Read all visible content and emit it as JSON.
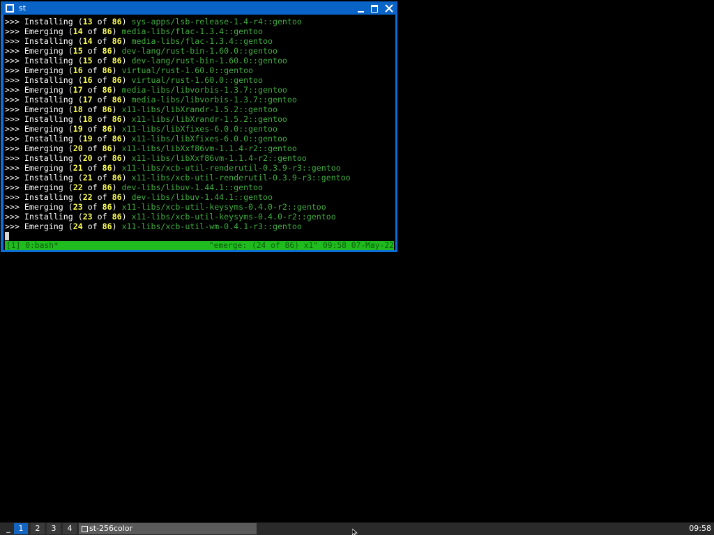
{
  "window": {
    "title": "st"
  },
  "terminal": {
    "lines": [
      {
        "prefix": ">>> ",
        "action": "Installing",
        "cur": "13",
        "of": "of",
        "total": "86",
        "pkg": "sys-apps/lsb-release-1.4-r4::gentoo"
      },
      {
        "prefix": ">>> ",
        "action": "Emerging",
        "cur": "14",
        "of": "of",
        "total": "86",
        "pkg": "media-libs/flac-1.3.4::gentoo"
      },
      {
        "prefix": ">>> ",
        "action": "Installing",
        "cur": "14",
        "of": "of",
        "total": "86",
        "pkg": "media-libs/flac-1.3.4::gentoo"
      },
      {
        "prefix": ">>> ",
        "action": "Emerging",
        "cur": "15",
        "of": "of",
        "total": "86",
        "pkg": "dev-lang/rust-bin-1.60.0::gentoo"
      },
      {
        "prefix": ">>> ",
        "action": "Installing",
        "cur": "15",
        "of": "of",
        "total": "86",
        "pkg": "dev-lang/rust-bin-1.60.0::gentoo"
      },
      {
        "prefix": ">>> ",
        "action": "Emerging",
        "cur": "16",
        "of": "of",
        "total": "86",
        "pkg": "virtual/rust-1.60.0::gentoo"
      },
      {
        "prefix": ">>> ",
        "action": "Installing",
        "cur": "16",
        "of": "of",
        "total": "86",
        "pkg": "virtual/rust-1.60.0::gentoo"
      },
      {
        "prefix": ">>> ",
        "action": "Emerging",
        "cur": "17",
        "of": "of",
        "total": "86",
        "pkg": "media-libs/libvorbis-1.3.7::gentoo"
      },
      {
        "prefix": ">>> ",
        "action": "Installing",
        "cur": "17",
        "of": "of",
        "total": "86",
        "pkg": "media-libs/libvorbis-1.3.7::gentoo"
      },
      {
        "prefix": ">>> ",
        "action": "Emerging",
        "cur": "18",
        "of": "of",
        "total": "86",
        "pkg": "x11-libs/libXrandr-1.5.2::gentoo"
      },
      {
        "prefix": ">>> ",
        "action": "Installing",
        "cur": "18",
        "of": "of",
        "total": "86",
        "pkg": "x11-libs/libXrandr-1.5.2::gentoo"
      },
      {
        "prefix": ">>> ",
        "action": "Emerging",
        "cur": "19",
        "of": "of",
        "total": "86",
        "pkg": "x11-libs/libXfixes-6.0.0::gentoo"
      },
      {
        "prefix": ">>> ",
        "action": "Installing",
        "cur": "19",
        "of": "of",
        "total": "86",
        "pkg": "x11-libs/libXfixes-6.0.0::gentoo"
      },
      {
        "prefix": ">>> ",
        "action": "Emerging",
        "cur": "20",
        "of": "of",
        "total": "86",
        "pkg": "x11-libs/libXxf86vm-1.1.4-r2::gentoo"
      },
      {
        "prefix": ">>> ",
        "action": "Installing",
        "cur": "20",
        "of": "of",
        "total": "86",
        "pkg": "x11-libs/libXxf86vm-1.1.4-r2::gentoo"
      },
      {
        "prefix": ">>> ",
        "action": "Emerging",
        "cur": "21",
        "of": "of",
        "total": "86",
        "pkg": "x11-libs/xcb-util-renderutil-0.3.9-r3::gentoo"
      },
      {
        "prefix": ">>> ",
        "action": "Installing",
        "cur": "21",
        "of": "of",
        "total": "86",
        "pkg": "x11-libs/xcb-util-renderutil-0.3.9-r3::gentoo"
      },
      {
        "prefix": ">>> ",
        "action": "Emerging",
        "cur": "22",
        "of": "of",
        "total": "86",
        "pkg": "dev-libs/libuv-1.44.1::gentoo"
      },
      {
        "prefix": ">>> ",
        "action": "Installing",
        "cur": "22",
        "of": "of",
        "total": "86",
        "pkg": "dev-libs/libuv-1.44.1::gentoo"
      },
      {
        "prefix": ">>> ",
        "action": "Emerging",
        "cur": "23",
        "of": "of",
        "total": "86",
        "pkg": "x11-libs/xcb-util-keysyms-0.4.0-r2::gentoo"
      },
      {
        "prefix": ">>> ",
        "action": "Installing",
        "cur": "23",
        "of": "of",
        "total": "86",
        "pkg": "x11-libs/xcb-util-keysyms-0.4.0-r2::gentoo"
      },
      {
        "prefix": ">>> ",
        "action": "Emerging",
        "cur": "24",
        "of": "of",
        "total": "86",
        "pkg": "x11-libs/xcb-util-wm-0.4.1-r3::gentoo"
      }
    ],
    "status_left": "[1] 0:bash*",
    "status_right": "\"emerge: (24 of 86) x1\" 09:58 07-May-22"
  },
  "taskbar": {
    "dash": "_",
    "workspaces": [
      "1",
      "2",
      "3",
      "4"
    ],
    "active_workspace": "1",
    "task_label": "st-256color",
    "clock": "09:58"
  },
  "colors": {
    "titlebar": "#0a64c8",
    "status_green": "#1fbb1f",
    "number_yellow": "#ffff55",
    "package_green": "#3fae3f"
  },
  "icons": [
    "window-icon",
    "minimize-icon",
    "maximize-icon",
    "close-icon",
    "mouse-pointer-icon"
  ]
}
